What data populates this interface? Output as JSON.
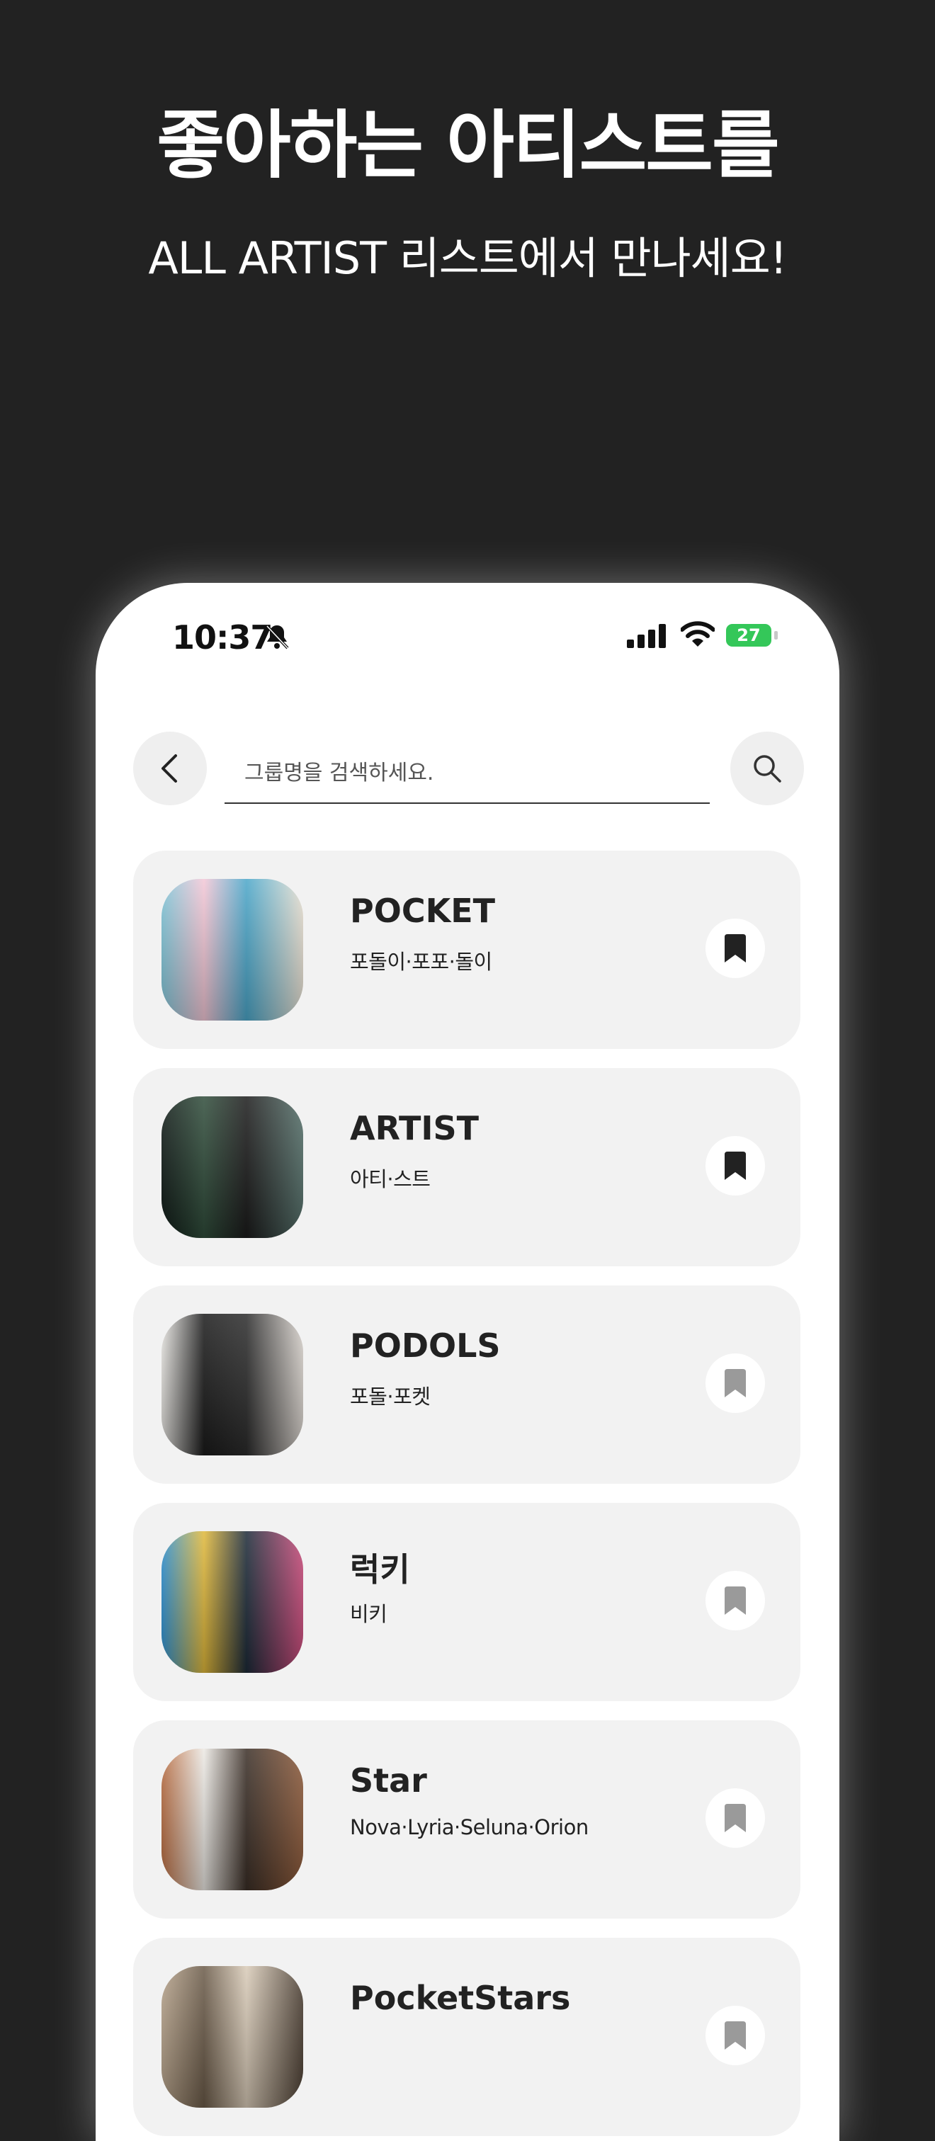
{
  "promo": {
    "title": "좋아하는 아티스트를",
    "subtitle": "ALL ARTIST 리스트에서 만나세요!"
  },
  "status_bar": {
    "time": "10:37",
    "battery": "27"
  },
  "search": {
    "placeholder": "그룹명을 검색하세요."
  },
  "artists": [
    {
      "name": "POCKET",
      "members": "포돌이·포포·돌이",
      "bookmarked": true,
      "thumb_colors": [
        "#7fc6d9",
        "#f3c7d6",
        "#4aa6c9",
        "#e9e1d3"
      ]
    },
    {
      "name": "ARTIST",
      "members": "아티·스트",
      "bookmarked": true,
      "thumb_colors": [
        "#0f1a16",
        "#2f4c3a",
        "#1b1b1b",
        "#55706a"
      ]
    },
    {
      "name": "PODOLS",
      "members": "포돌·포켓",
      "bookmarked": false,
      "thumb_colors": [
        "#e9e7e3",
        "#1a1a1a",
        "#2b2b2b",
        "#d9d3cd"
      ]
    },
    {
      "name": "럭키",
      "members": "비키",
      "bookmarked": false,
      "thumb_colors": [
        "#2b8fd1",
        "#e0b83a",
        "#1c2a38",
        "#c94a7a"
      ]
    },
    {
      "name": "Star",
      "members": "Nova·Lyria·Seluna·Orion",
      "bookmarked": false,
      "thumb_colors": [
        "#b86b3f",
        "#ece9e4",
        "#3a2e26",
        "#8d5a3a"
      ]
    },
    {
      "name": "PocketStars",
      "members": "",
      "bookmarked": false,
      "thumb_colors": [
        "#b8a48c",
        "#6a5a48",
        "#d9cbb8",
        "#4a3d31"
      ]
    }
  ],
  "colors": {
    "background": "#222222",
    "card": "#f2f2f2",
    "bookmark_on": "#222222",
    "bookmark_off": "#9a9a9a",
    "battery": "#34c759"
  }
}
